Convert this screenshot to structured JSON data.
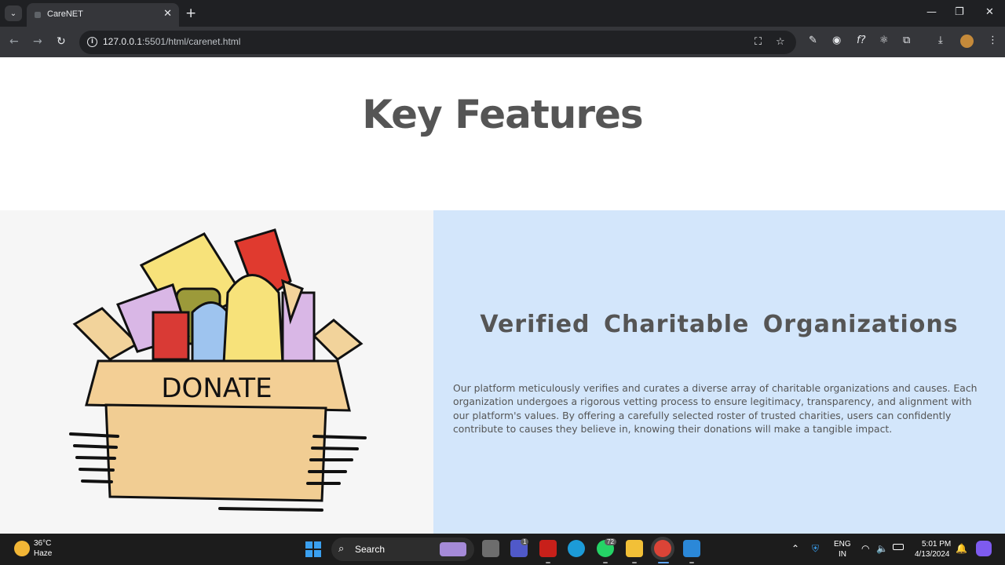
{
  "browser": {
    "tab_title": "CareNET",
    "url_host": "127.0.0.1",
    "url_rest": ":5501/html/carenet.html"
  },
  "page": {
    "heading": "Key Features",
    "feature_title": "Verified Charitable Organizations",
    "feature_description": "Our platform meticulously verifies and curates a diverse array of charitable organizations and causes. Each organization undergoes a rigorous vetting process to ensure legitimacy, transparency, and alignment with our platform's values. By offering a carefully selected roster of trusted charities, users can confidently contribute to causes they believe in, knowing their donations will make a tangible impact.",
    "image_text": "DONATE"
  },
  "taskbar": {
    "weather_temp": "36°C",
    "weather_condition": "Haze",
    "search_label": "Search",
    "teams_badge": "1",
    "whatsapp_badge": "72",
    "lang_primary": "ENG",
    "lang_secondary": "IN",
    "time": "5:01 PM",
    "date": "4/13/2024"
  }
}
